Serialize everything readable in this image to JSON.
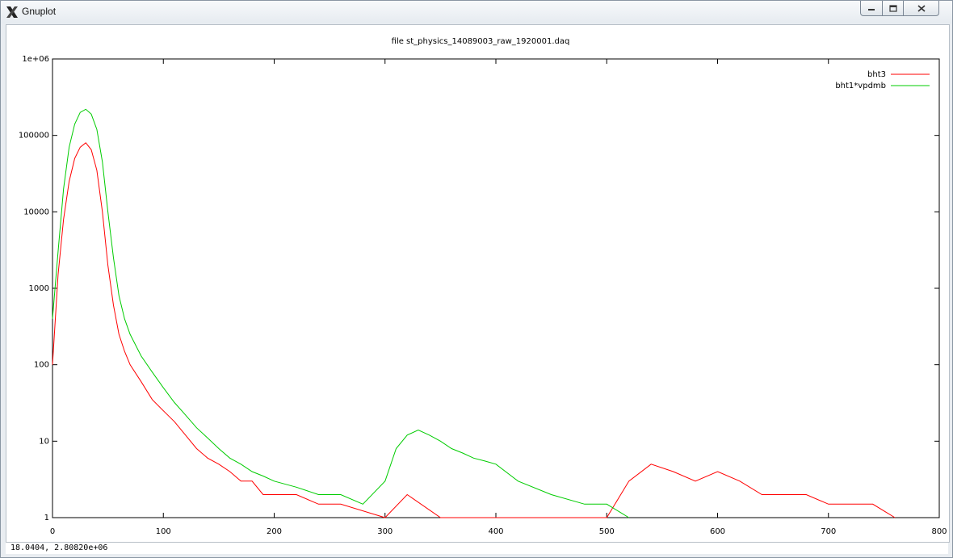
{
  "window": {
    "title": "Gnuplot",
    "controls": {
      "minimize_icon": "minimize-icon",
      "maximize_icon": "maximize-icon",
      "close_icon": "close-icon"
    }
  },
  "status": {
    "coordinates": "18.0404,  2.80820e+06"
  },
  "chart_data": {
    "type": "line",
    "title": "file st_physics_14089003_raw_1920001.daq",
    "xlabel": "",
    "ylabel": "",
    "xlim": [
      0,
      800
    ],
    "ylim": [
      1,
      1000000
    ],
    "yscale": "log",
    "x_ticks": [
      "0",
      "100",
      "200",
      "300",
      "400",
      "500",
      "600",
      "700",
      "800"
    ],
    "y_ticks": [
      "1",
      "10",
      "100",
      "1000",
      "10000",
      "100000",
      "1e+06"
    ],
    "grid": false,
    "legend_position": "top-right",
    "series": [
      {
        "name": "bht3",
        "color": "#ff0000",
        "x": [
          0,
          5,
          10,
          15,
          20,
          25,
          30,
          35,
          40,
          45,
          50,
          55,
          60,
          65,
          70,
          80,
          90,
          100,
          110,
          120,
          130,
          140,
          150,
          160,
          170,
          180,
          190,
          200,
          220,
          240,
          260,
          300,
          320,
          350,
          400,
          450,
          500,
          520,
          540,
          560,
          580,
          600,
          620,
          640,
          660,
          680,
          700,
          720,
          740,
          760
        ],
        "y": [
          100,
          1500,
          8000,
          25000,
          50000,
          70000,
          80000,
          65000,
          35000,
          10000,
          2000,
          600,
          250,
          150,
          100,
          60,
          35,
          25,
          18,
          12,
          8,
          6,
          5,
          4,
          3,
          3,
          2,
          2,
          2,
          1.5,
          1.5,
          1,
          2,
          1,
          1,
          1,
          1,
          3,
          5,
          4,
          3,
          4,
          3,
          2,
          2,
          2,
          1.5,
          1.5,
          1.5,
          1
        ]
      },
      {
        "name": "bht1*vpdmb",
        "color": "#00cc00",
        "x": [
          0,
          5,
          10,
          15,
          20,
          25,
          30,
          35,
          40,
          45,
          50,
          55,
          60,
          65,
          70,
          80,
          90,
          100,
          110,
          120,
          130,
          140,
          150,
          160,
          170,
          180,
          190,
          200,
          220,
          240,
          260,
          280,
          300,
          310,
          320,
          330,
          340,
          350,
          360,
          370,
          380,
          390,
          400,
          420,
          450,
          480,
          500,
          520
        ],
        "y": [
          400,
          3000,
          20000,
          70000,
          140000,
          200000,
          220000,
          190000,
          120000,
          45000,
          10000,
          2500,
          800,
          400,
          250,
          130,
          80,
          50,
          32,
          22,
          15,
          11,
          8,
          6,
          5,
          4,
          3.5,
          3,
          2.5,
          2,
          2,
          1.5,
          3,
          8,
          12,
          14,
          12,
          10,
          8,
          7,
          6,
          5.5,
          5,
          3,
          2,
          1.5,
          1.5,
          1
        ]
      }
    ]
  }
}
